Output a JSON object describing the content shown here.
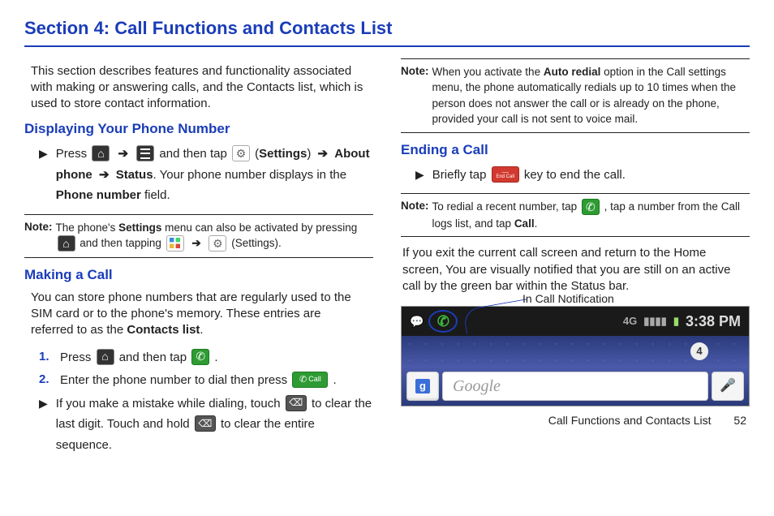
{
  "section_title": "Section 4: Call Functions and Contacts List",
  "intro": "This section describes features and functionality associated with making or answering calls, and the Contacts list, which is used to store contact information.",
  "displaying": {
    "heading": "Displaying Your Phone Number",
    "line1_press": "Press",
    "line1_andthentap": "and then tap",
    "line1_settings_paren": "(Settings)",
    "line2_about": "About phone",
    "line2_status": "Status",
    "line2_rest": ". Your phone number displays in the",
    "line3_field": "Phone number",
    "line3_rest": " field."
  },
  "note1": {
    "label": "Note:",
    "part1": "The phone's ",
    "settings": "Settings",
    "part2": " menu can also be activated by pressing ",
    "part3": " and then tapping ",
    "settings_paren": "(Settings)."
  },
  "making": {
    "heading": "Making a Call",
    "intro_a": "You can store phone numbers that are regularly used to the SIM card or to the phone's memory. These entries are referred to as the ",
    "contacts_list": "Contacts list",
    "step1_a": "Press ",
    "step1_b": " and then tap ",
    "step2": "Enter the phone number to dial then press ",
    "call_label": "Call",
    "mistake_a": "If you make a mistake while dialing, touch ",
    "mistake_b": " to clear the last digit. Touch and hold ",
    "mistake_c": " to clear the entire sequence."
  },
  "note2": {
    "label": "Note:",
    "part1": "When you activate the ",
    "auto": "Auto redial",
    "part2": " option in the Call settings menu, the phone automatically redials up to 10 times when the person does not answer the call or is already on the phone, provided your call is not sent to voice mail."
  },
  "ending": {
    "heading": "Ending a Call",
    "a": "Briefly tap ",
    "end_label": "End Call",
    "b": " key to end the call."
  },
  "note3": {
    "label": "Note:",
    "part1": "To redial a recent number, tap ",
    "part2": " , tap a number from the Call logs list, and tap ",
    "call": "Call",
    "part3": "."
  },
  "exit_para": "If you exit the current call screen and return to the Home screen, You are visually notified that you are still on an active call by the green bar within the Status bar.",
  "callout": "In Call Notification",
  "statusbar": {
    "time": "3:38 PM",
    "sig_4g": "4G",
    "page_badge": "4"
  },
  "search_placeholder": "Google",
  "g_letter": "g",
  "footer_text": "Call Functions and Contacts List",
  "page_number": "52",
  "arrow": "➔"
}
